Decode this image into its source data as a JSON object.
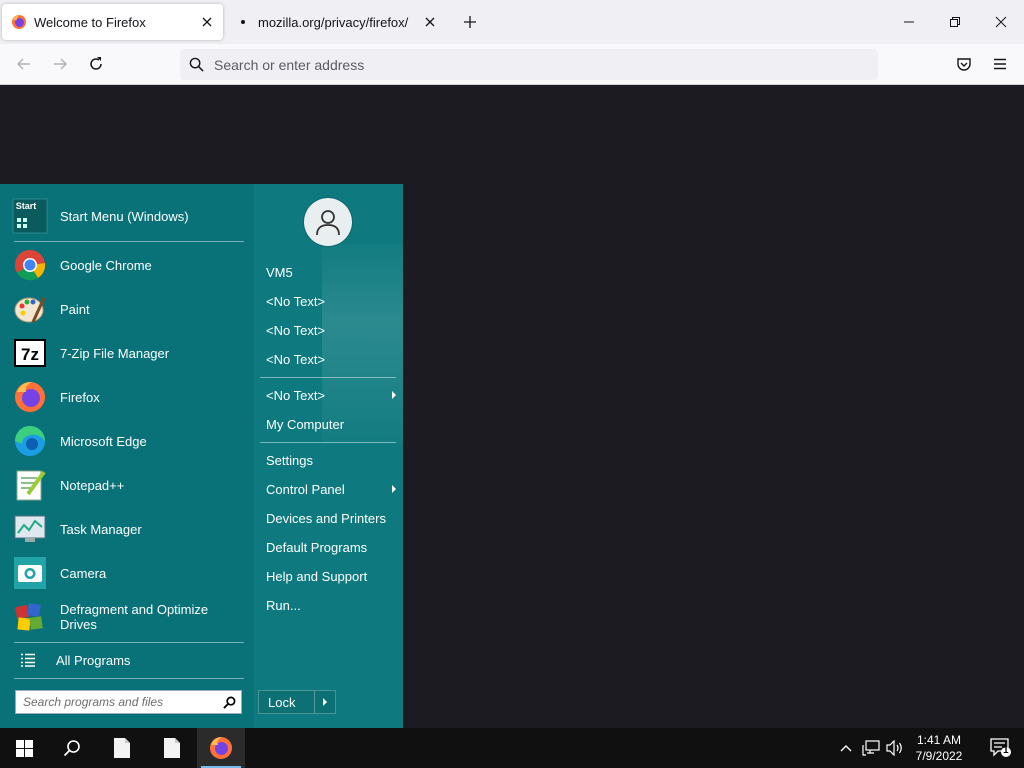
{
  "browser": {
    "tabs": [
      {
        "title": "Welcome to Firefox",
        "active": true
      },
      {
        "title": "mozilla.org/privacy/firefox/",
        "active": false
      }
    ],
    "urlbar": {
      "placeholder": "Search or enter address",
      "value": ""
    }
  },
  "start_menu": {
    "programs": [
      {
        "label": "Start Menu (Windows)",
        "icon": "start-menu-icon"
      },
      {
        "label": "Google Chrome",
        "icon": "chrome-icon"
      },
      {
        "label": "Paint",
        "icon": "paint-icon"
      },
      {
        "label": "7-Zip File Manager",
        "icon": "7zip-icon"
      },
      {
        "label": "Firefox",
        "icon": "firefox-icon"
      },
      {
        "label": "Microsoft Edge",
        "icon": "edge-icon"
      },
      {
        "label": "Notepad++",
        "icon": "notepadpp-icon"
      },
      {
        "label": "Task Manager",
        "icon": "task-manager-icon"
      },
      {
        "label": "Camera",
        "icon": "camera-icon"
      },
      {
        "label": "Defragment and Optimize Drives",
        "icon": "defrag-icon"
      }
    ],
    "start_icon_text": "Start",
    "all_programs": "All Programs",
    "search_placeholder": "Search programs and files",
    "right_items": [
      {
        "label": "VM5",
        "submenu": false
      },
      {
        "label": "<No Text>",
        "submenu": false
      },
      {
        "label": "<No Text>",
        "submenu": false
      },
      {
        "label": "<No Text>",
        "submenu": false
      },
      {
        "label": "<No Text>",
        "submenu": true
      },
      {
        "label": "My Computer",
        "submenu": false
      },
      {
        "label": "Settings",
        "submenu": false
      },
      {
        "label": "Control Panel",
        "submenu": true
      },
      {
        "label": "Devices and Printers",
        "submenu": false
      },
      {
        "label": "Default Programs",
        "submenu": false
      },
      {
        "label": "Help and Support",
        "submenu": false
      },
      {
        "label": "Run...",
        "submenu": false
      }
    ],
    "lock": "Lock"
  },
  "taskbar": {
    "time": "1:41 AM",
    "date": "7/9/2022",
    "notification_count": "1"
  },
  "colors": {
    "menu_left": "#087278",
    "menu_right": "#0e7a7f",
    "taskbar": "#101010",
    "content_bg": "#1c1b22"
  }
}
